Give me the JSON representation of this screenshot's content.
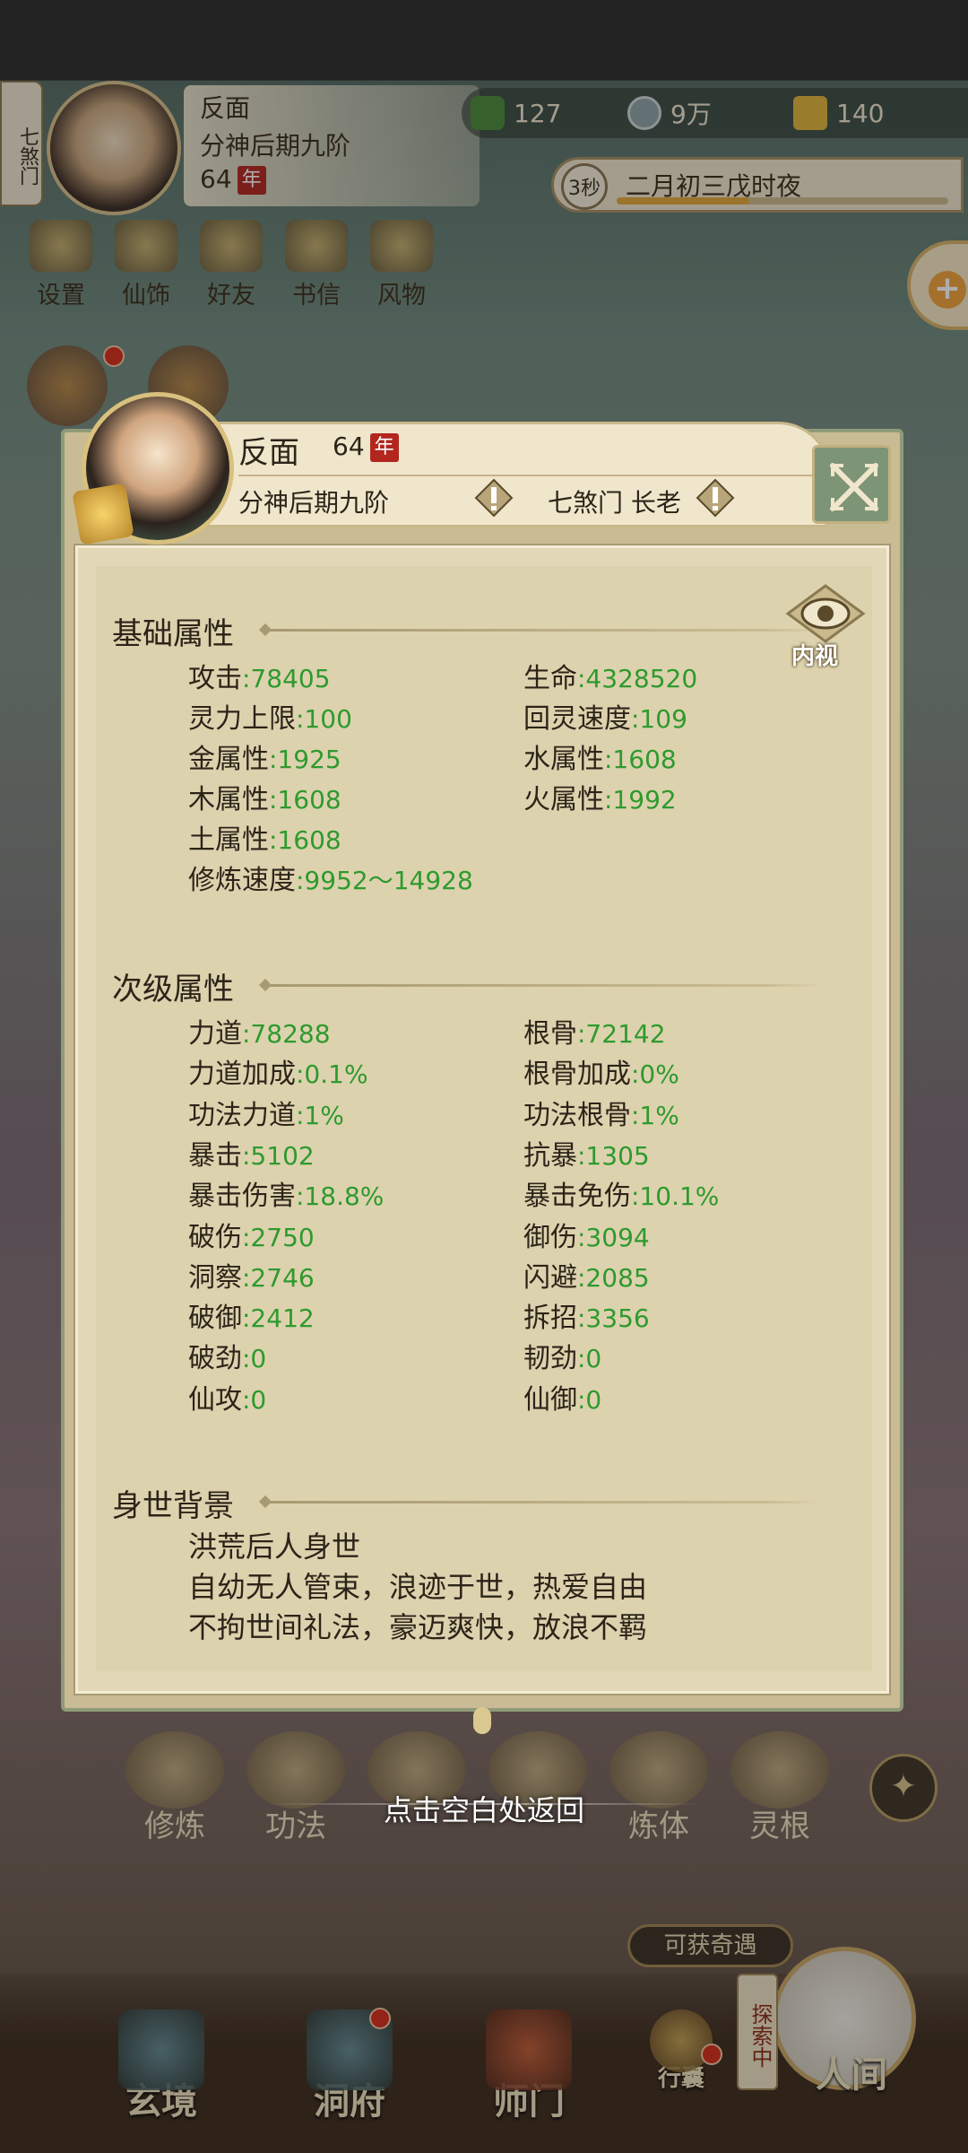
{
  "hud": {
    "sect_tag": "七煞门",
    "name": "反面",
    "realm": "分神后期九阶",
    "age": "64",
    "age_unit": "年",
    "resources": [
      {
        "icon": "jade-leaf-icon",
        "value": "127"
      },
      {
        "icon": "coin-icon",
        "value": "9万"
      },
      {
        "icon": "muscle-icon",
        "value": "140"
      }
    ],
    "timer_seconds": "3秒",
    "game_date": "二月初三戊时夜",
    "time_progress": 0.4,
    "top_icons": [
      "设置",
      "仙饰",
      "好友",
      "书信",
      "风物"
    ]
  },
  "modal": {
    "name": "反面",
    "age": "64",
    "age_unit": "年",
    "realm": "分神后期九阶",
    "sect": "七煞门 长老",
    "inner_view_label": "内视",
    "sections": {
      "basic": {
        "title": "基础属性",
        "stats": [
          {
            "label": "攻击",
            "value": ":78405"
          },
          {
            "label": "生命",
            "value": ":4328520"
          },
          {
            "label": "灵力上限",
            "value": ":100"
          },
          {
            "label": "回灵速度",
            "value": ":109"
          },
          {
            "label": "金属性",
            "value": ":1925"
          },
          {
            "label": "水属性",
            "value": ":1608"
          },
          {
            "label": "木属性",
            "value": ":1608"
          },
          {
            "label": "火属性",
            "value": ":1992"
          },
          {
            "label": "土属性",
            "value": ":1608"
          },
          {
            "label": "修炼速度",
            "value": ":9952～14928"
          }
        ]
      },
      "secondary": {
        "title": "次级属性",
        "stats": [
          {
            "label": "力道",
            "value": ":78288"
          },
          {
            "label": "根骨",
            "value": ":72142"
          },
          {
            "label": "力道加成",
            "value": ":0.1%"
          },
          {
            "label": "根骨加成",
            "value": ":0%"
          },
          {
            "label": "功法力道",
            "value": ":1%"
          },
          {
            "label": "功法根骨",
            "value": ":1%"
          },
          {
            "label": "暴击",
            "value": ":5102"
          },
          {
            "label": "抗暴",
            "value": ":1305"
          },
          {
            "label": "暴击伤害",
            "value": ":18.8%"
          },
          {
            "label": "暴击免伤",
            "value": ":10.1%"
          },
          {
            "label": "破伤",
            "value": ":2750"
          },
          {
            "label": "御伤",
            "value": ":3094"
          },
          {
            "label": "洞察",
            "value": ":2746"
          },
          {
            "label": "闪避",
            "value": ":2085"
          },
          {
            "label": "破御",
            "value": ":2412"
          },
          {
            "label": "拆招",
            "value": ":3356"
          },
          {
            "label": "破劲",
            "value": ":0"
          },
          {
            "label": "韧劲",
            "value": ":0"
          },
          {
            "label": "仙攻",
            "value": ":0"
          },
          {
            "label": "仙御",
            "value": ":0"
          }
        ]
      },
      "background": {
        "title": "身世背景",
        "lines": [
          "洪荒后人身世",
          "自幼无人管束，浪迹于世，热爱自由",
          "不拘世间礼法，豪迈爽快，放浪不羁"
        ]
      }
    }
  },
  "function_row": [
    "修炼",
    "功法",
    "",
    "",
    "炼体",
    "灵根"
  ],
  "return_hint": "点击空白处返回",
  "adventure_tag": "可获奇遇",
  "explore_tag": "探索中",
  "bottom_nav": [
    "玄境",
    "洞府",
    "师门",
    "行囊",
    "人间"
  ]
}
